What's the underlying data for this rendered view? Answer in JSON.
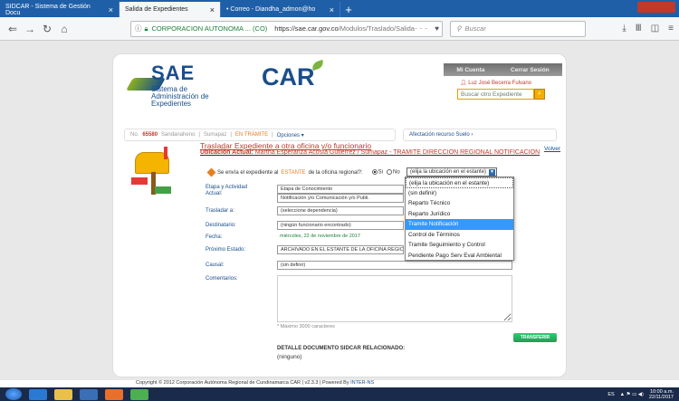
{
  "browser": {
    "tabs": [
      {
        "label": "SIDCAR - Sistema de Gestión Docu"
      },
      {
        "label": "Salida de Expedientes"
      },
      {
        "label": "• Correo - Diandha_admon@ho"
      }
    ],
    "url_org": "CORPORACION AUTONOMA ... (CO)",
    "url_domain": "https://sae.car.gov.co",
    "url_path": "/Modulos/Traslado/Salida",
    "search_placeholder": "Buscar"
  },
  "header": {
    "logo_sae": "SAE",
    "logo_sub": "Sistema de Administración de Expedientes",
    "logo_car": "CAR",
    "mi_cuenta": "Mi Cuenta",
    "cerrar_sesion": "Cerrar Sesión",
    "user_name": "Luz José Becerra Fulvano",
    "search_placeholder": "Buscar otro Expediente"
  },
  "status": {
    "no_label": "No.",
    "number": "65580",
    "item1": "Sandanaheno",
    "item2": "Sumapaz",
    "tramite": "EN TRÁMITE",
    "opciones": "Opciones ▾",
    "alert": "Afectación recurso Suelo ›"
  },
  "main": {
    "title": "Trasladar Expediente a otra oficina y/o funcionario",
    "ubicacion_label": "Ubicación Actual:",
    "ubicacion_value": "Martha Esperanza Acosta Gutierrez / Sumapaz - TRAMITE DIRECCION REGIONAL NOTIFICACION",
    "volver": "Volver",
    "question_pre": "Se envía el expediente al",
    "question_est": "ESTANTE",
    "question_post": "de la oficina regional?:",
    "si": "Si",
    "no": "No",
    "select_value": "(elija la ubicación en el estante)"
  },
  "form": {
    "etapa_label": "Etapa y Actividad Actual:",
    "etapa_value1": "Etapa de Conocimiento",
    "etapa_value2": "Notificación y/o Comunicación y/o Publi.",
    "trasladar_label": "Trasladar a:",
    "trasladar_value": "(seleccione dependencia)",
    "destinatario_label": "Destinatario:",
    "destinatario_value": "(ningún funcionario encontrado)",
    "fecha_label": "Fecha:",
    "fecha_value": "miércoles, 22 de noviembre de 2017",
    "proximo_label": "Próximo Estado:",
    "proximo_value": "ARCHIVADO EN EL ESTANTE DE LA OFICINA REGIONAL",
    "causal_label": "Causal:",
    "causal_value": "(sin definir)",
    "comentarios_label": "Comentarios:",
    "hint": "* Máximo 3000 caracteres",
    "transferir": "TRANSFERIR",
    "detalle": "DETALLE DOCUMENTO SIDCAR RELACIONADO:",
    "ninguno": "(ninguno)"
  },
  "dropdown": {
    "options": [
      "(elija la ubicación en el estante)",
      "(sin definir)",
      "Reparto Técnico",
      "Reparto Jurídico",
      "Tramite Notificación",
      "Control de Términos",
      "Tramite Seguimiento y Control",
      "Pendiente Pago Serv Eval Ambiental"
    ],
    "selected_index": 4
  },
  "footer": {
    "text": "Copyright © 2012 Corporación Autónoma Regional de Cundinamarca CAR | v2.3.3 | Powered By",
    "brand": "INTER-NS"
  },
  "taskbar": {
    "lang": "ES",
    "time": "10:00 a.m.",
    "date": "22/11/2017"
  },
  "colors": {
    "accent_blue": "#1a4e8c",
    "accent_red": "#c0392b",
    "selection": "#3399ff",
    "transfer_green": "#2ecc71"
  }
}
